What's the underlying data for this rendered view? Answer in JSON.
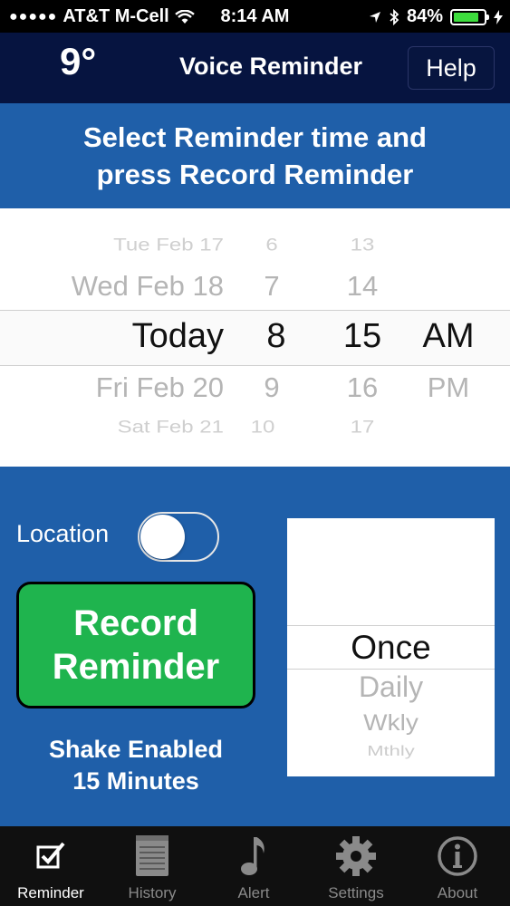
{
  "status_bar": {
    "carrier": "AT&T M-Cell",
    "time": "8:14 AM",
    "battery": "84%",
    "battery_level": 0.84
  },
  "nav": {
    "temperature": "9°",
    "title": "Voice Reminder",
    "help_label": "Help"
  },
  "instruction": {
    "line1": "Select Reminder time and",
    "line2": "press Record Reminder"
  },
  "picker": {
    "days": [
      "Tue Feb 17",
      "Wed Feb 18",
      "Today",
      "Fri Feb 20",
      "Sat Feb 21"
    ],
    "hours": [
      "6",
      "7",
      "8",
      "9",
      "10"
    ],
    "minutes": [
      "13",
      "14",
      "15",
      "16",
      "17"
    ],
    "ampm": [
      "",
      "",
      "AM",
      "PM",
      ""
    ],
    "selected": {
      "day": "Today",
      "hour": "8",
      "minute": "15",
      "period": "AM"
    }
  },
  "location": {
    "label": "Location",
    "enabled": false
  },
  "record_button": {
    "line1": "Record",
    "line2": "Reminder"
  },
  "shake_info": {
    "line1": "Shake Enabled",
    "line2": "15 Minutes"
  },
  "repeat_picker": {
    "options": [
      "Once",
      "Daily",
      "Wkly",
      "Mthly"
    ],
    "selected": "Once"
  },
  "tabs": [
    {
      "label": "Reminder",
      "icon": "checkbox-pencil-icon",
      "active": true
    },
    {
      "label": "History",
      "icon": "notepad-icon",
      "active": false
    },
    {
      "label": "Alert",
      "icon": "music-note-icon",
      "active": false
    },
    {
      "label": "Settings",
      "icon": "gear-icon",
      "active": false
    },
    {
      "label": "About",
      "icon": "info-icon",
      "active": false
    }
  ],
  "colors": {
    "nav_bg": "#061440",
    "panel_blue": "#1f5fa9",
    "record_green": "#1fb44e",
    "battery_green": "#3ddc3d"
  }
}
